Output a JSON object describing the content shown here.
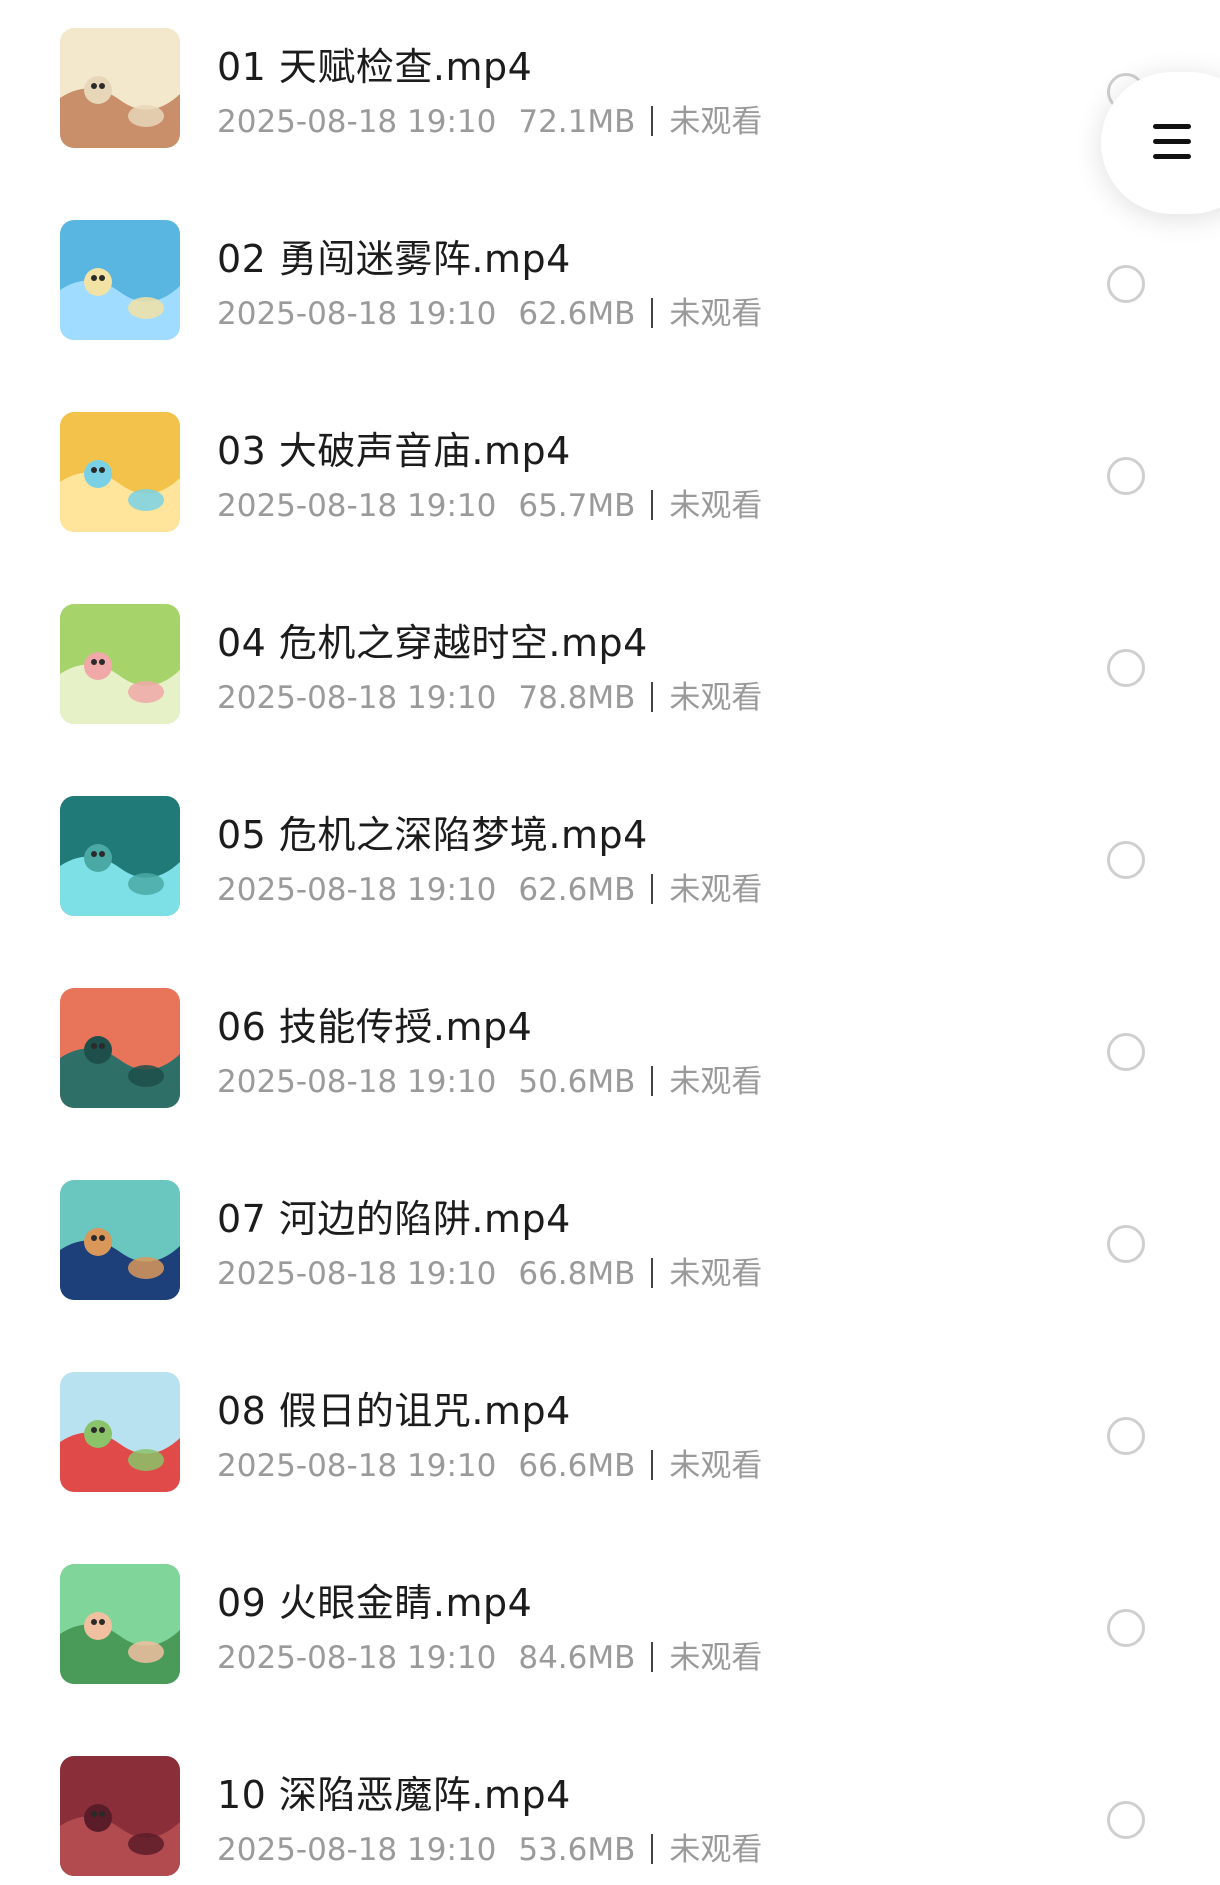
{
  "files": [
    {
      "name": "01 天赋检查.mp4",
      "date": "2025-08-18 19:10",
      "size": "72.1MB",
      "status": "未观看",
      "thumb_colors": [
        "#f4e8cc",
        "#c98f6a",
        "#e8d6b8"
      ]
    },
    {
      "name": "02 勇闯迷雾阵.mp4",
      "date": "2025-08-18 19:10",
      "size": "62.6MB",
      "status": "未观看",
      "thumb_colors": [
        "#58b6e0",
        "#9fdcff",
        "#f2e2a4"
      ]
    },
    {
      "name": "03 大破声音庙.mp4",
      "date": "2025-08-18 19:10",
      "size": "65.7MB",
      "status": "未观看",
      "thumb_colors": [
        "#f3c24a",
        "#ffe59b",
        "#7ad1e6"
      ]
    },
    {
      "name": "04 危机之穿越时空.mp4",
      "date": "2025-08-18 19:10",
      "size": "78.8MB",
      "status": "未观看",
      "thumb_colors": [
        "#a6d36a",
        "#e7f1c8",
        "#f0a8a8"
      ]
    },
    {
      "name": "05 危机之深陷梦境.mp4",
      "date": "2025-08-18 19:10",
      "size": "62.6MB",
      "status": "未观看",
      "thumb_colors": [
        "#1f7a78",
        "#7de0e6",
        "#4aa9a5"
      ]
    },
    {
      "name": "06 技能传授.mp4",
      "date": "2025-08-18 19:10",
      "size": "50.6MB",
      "status": "未观看",
      "thumb_colors": [
        "#e8745a",
        "#2e6f68",
        "#1f4f4a"
      ]
    },
    {
      "name": "07 河边的陷阱.mp4",
      "date": "2025-08-18 19:10",
      "size": "66.8MB",
      "status": "未观看",
      "thumb_colors": [
        "#6ac7c0",
        "#1d3f7a",
        "#d9985a"
      ]
    },
    {
      "name": "08 假日的诅咒.mp4",
      "date": "2025-08-18 19:10",
      "size": "66.6MB",
      "status": "未观看",
      "thumb_colors": [
        "#b9e2f0",
        "#e04a48",
        "#8ac36a"
      ]
    },
    {
      "name": "09 火眼金睛.mp4",
      "date": "2025-08-18 19:10",
      "size": "84.6MB",
      "status": "未观看",
      "thumb_colors": [
        "#7fd59a",
        "#4a9a5a",
        "#f0c0a0"
      ]
    },
    {
      "name": "10 深陷恶魔阵.mp4",
      "date": "2025-08-18 19:10",
      "size": "53.6MB",
      "status": "未观看",
      "thumb_colors": [
        "#8a2e3a",
        "#b24b4f",
        "#5a1c28"
      ]
    }
  ],
  "menu_button": {
    "icon": "hamburger-menu-icon"
  },
  "colors": {
    "name_text": "#1c1c1c",
    "meta_text": "#9a9a9a",
    "circle_border": "#cfcfcf"
  }
}
